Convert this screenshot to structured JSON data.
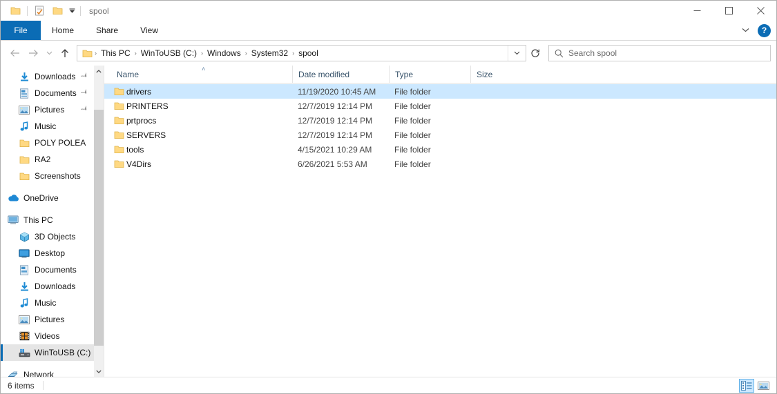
{
  "window": {
    "title": "spool",
    "controls": {
      "minimize": "minimize-icon",
      "maximize": "maximize-icon",
      "close": "close-icon"
    }
  },
  "quick_access_toolbar": {
    "items": [
      {
        "name": "folder-icon",
        "label": ""
      },
      {
        "name": "properties-icon",
        "label": ""
      },
      {
        "name": "new-folder-icon",
        "label": ""
      }
    ],
    "dropdown": "chevron-down-icon"
  },
  "ribbon": {
    "tabs": [
      {
        "label": "File",
        "active": true
      },
      {
        "label": "Home",
        "active": false
      },
      {
        "label": "Share",
        "active": false
      },
      {
        "label": "View",
        "active": false
      }
    ],
    "expand_icon": "chevron-down-icon",
    "help_label": "?"
  },
  "navigation": {
    "back": "back-arrow-icon",
    "forward": "forward-arrow-icon",
    "recent": "chevron-down-icon",
    "up": "up-arrow-icon",
    "refresh": "refresh-icon",
    "dropdown": "chevron-down-icon",
    "breadcrumbs": [
      {
        "label": "This PC"
      },
      {
        "label": "WinToUSB (C:)"
      },
      {
        "label": "Windows"
      },
      {
        "label": "System32"
      },
      {
        "label": "spool"
      }
    ],
    "separator": "›"
  },
  "search": {
    "placeholder": "Search spool",
    "icon": "search-icon"
  },
  "sidebar": {
    "items": [
      {
        "label": "Downloads",
        "icon": "download-arrow-icon",
        "indent": 1,
        "pinned": true,
        "selected": false
      },
      {
        "label": "Documents",
        "icon": "document-icon",
        "indent": 1,
        "pinned": true,
        "selected": false
      },
      {
        "label": "Pictures",
        "icon": "picture-icon",
        "indent": 1,
        "pinned": true,
        "selected": false
      },
      {
        "label": "Music",
        "icon": "music-note-icon",
        "indent": 1,
        "pinned": false,
        "selected": false
      },
      {
        "label": "POLY POLEA",
        "icon": "folder-icon",
        "indent": 1,
        "pinned": false,
        "selected": false
      },
      {
        "label": "RA2",
        "icon": "folder-icon",
        "indent": 1,
        "pinned": false,
        "selected": false
      },
      {
        "label": "Screenshots",
        "icon": "folder-icon",
        "indent": 1,
        "pinned": false,
        "selected": false
      },
      {
        "label": "",
        "icon": "spacer",
        "indent": 0,
        "pinned": false,
        "selected": false
      },
      {
        "label": "OneDrive",
        "icon": "cloud-icon",
        "indent": 0,
        "pinned": false,
        "selected": false
      },
      {
        "label": "",
        "icon": "spacer",
        "indent": 0,
        "pinned": false,
        "selected": false
      },
      {
        "label": "This PC",
        "icon": "monitor-icon",
        "indent": 0,
        "pinned": false,
        "selected": false
      },
      {
        "label": "3D Objects",
        "icon": "cube-icon",
        "indent": 1,
        "pinned": false,
        "selected": false
      },
      {
        "label": "Desktop",
        "icon": "desktop-icon",
        "indent": 1,
        "pinned": false,
        "selected": false
      },
      {
        "label": "Documents",
        "icon": "document-icon",
        "indent": 1,
        "pinned": false,
        "selected": false
      },
      {
        "label": "Downloads",
        "icon": "download-arrow-icon",
        "indent": 1,
        "pinned": false,
        "selected": false
      },
      {
        "label": "Music",
        "icon": "music-note-icon",
        "indent": 1,
        "pinned": false,
        "selected": false
      },
      {
        "label": "Pictures",
        "icon": "picture-icon",
        "indent": 1,
        "pinned": false,
        "selected": false
      },
      {
        "label": "Videos",
        "icon": "video-icon",
        "indent": 1,
        "pinned": false,
        "selected": false
      },
      {
        "label": "WinToUSB (C:)",
        "icon": "drive-icon",
        "indent": 1,
        "pinned": false,
        "selected": true
      },
      {
        "label": "",
        "icon": "spacer",
        "indent": 0,
        "pinned": false,
        "selected": false
      },
      {
        "label": "Network",
        "icon": "network-icon",
        "indent": 0,
        "pinned": false,
        "selected": false
      }
    ],
    "scrollbar": {
      "up": "chevron-up-icon",
      "down": "chevron-down-icon"
    }
  },
  "file_list": {
    "columns": [
      {
        "label": "Name",
        "sorted": "asc"
      },
      {
        "label": "Date modified",
        "sorted": ""
      },
      {
        "label": "Type",
        "sorted": ""
      },
      {
        "label": "Size",
        "sorted": ""
      }
    ],
    "sort_indicator": "˄",
    "rows": [
      {
        "name": "drivers",
        "date": "11/19/2020 10:45 AM",
        "type": "File folder",
        "size": "",
        "selected": true
      },
      {
        "name": "PRINTERS",
        "date": "12/7/2019 12:14 PM",
        "type": "File folder",
        "size": "",
        "selected": false
      },
      {
        "name": "prtprocs",
        "date": "12/7/2019 12:14 PM",
        "type": "File folder",
        "size": "",
        "selected": false
      },
      {
        "name": "SERVERS",
        "date": "12/7/2019 12:14 PM",
        "type": "File folder",
        "size": "",
        "selected": false
      },
      {
        "name": "tools",
        "date": "4/15/2021 10:29 AM",
        "type": "File folder",
        "size": "",
        "selected": false
      },
      {
        "name": "V4Dirs",
        "date": "6/26/2021 5:53 AM",
        "type": "File folder",
        "size": "",
        "selected": false
      }
    ]
  },
  "status_bar": {
    "item_count": "6 items",
    "views": [
      {
        "name": "details-view-icon",
        "active": true
      },
      {
        "name": "large-icons-view-icon",
        "active": false
      }
    ]
  },
  "colors": {
    "accent": "#0b6cb5",
    "selection": "#cce8ff",
    "folder_yellow": "#ffd983",
    "header_text": "#39546b"
  }
}
